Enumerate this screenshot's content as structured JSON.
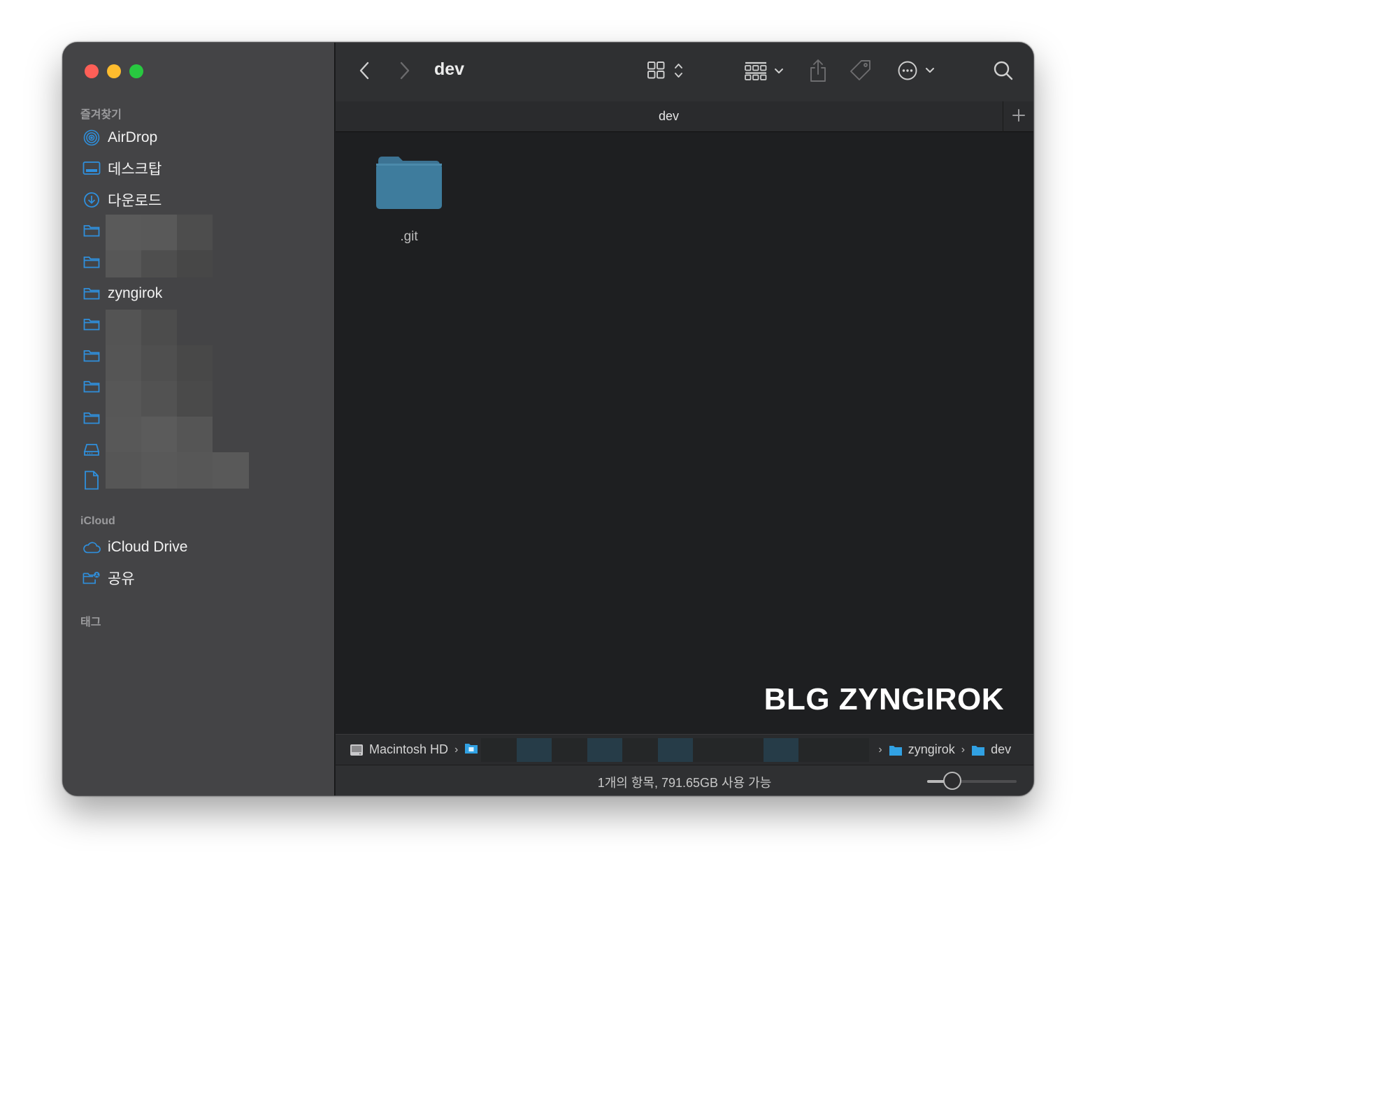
{
  "window": {
    "title": "dev"
  },
  "sidebar": {
    "favorites_title": "즐겨찾기",
    "items": [
      {
        "label": "AirDrop",
        "icon": "airdrop-icon"
      },
      {
        "label": "데스크탑",
        "icon": "desktop-icon"
      },
      {
        "label": "다운로드",
        "icon": "download-icon"
      },
      {
        "label": "",
        "icon": "folder-icon"
      },
      {
        "label": "",
        "icon": "folder-icon"
      },
      {
        "label": "zyngirok",
        "icon": "folder-icon"
      },
      {
        "label": "",
        "icon": "folder-icon"
      },
      {
        "label": "",
        "icon": "folder-icon"
      },
      {
        "label": "",
        "icon": "folder-icon"
      },
      {
        "label": "",
        "icon": "folder-icon"
      },
      {
        "label": "",
        "icon": "drive-icon"
      },
      {
        "label": "",
        "icon": "document-icon"
      }
    ],
    "icloud_title": "iCloud",
    "icloud_items": [
      {
        "label": "iCloud Drive",
        "icon": "cloud-icon"
      },
      {
        "label": "공유",
        "icon": "shared-folder-icon"
      }
    ],
    "tags_title": "태그"
  },
  "tab": {
    "title": "dev"
  },
  "files": [
    {
      "name": ".git",
      "type": "folder"
    }
  ],
  "watermark": "BLG ZYNGIROK",
  "pathbar": {
    "root": "Macintosh HD",
    "crumbs": [
      "zyngirok",
      "dev"
    ]
  },
  "status": {
    "text": "1개의 항목, 791.65GB 사용 가능",
    "zoom_level": 0.28
  },
  "colors": {
    "accent": "#2f8fdc",
    "folder": "#3d7a9b",
    "sidebar": "#444446",
    "content": "#1e1f21"
  }
}
